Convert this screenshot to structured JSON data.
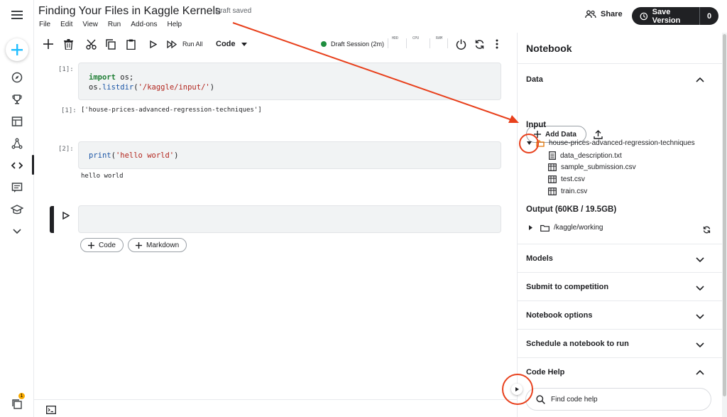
{
  "header": {
    "title": "Finding Your Files in Kaggle Kernels",
    "draft_status": "Draft saved",
    "menu": [
      "File",
      "Edit",
      "View",
      "Run",
      "Add-ons",
      "Help"
    ],
    "share_label": "Share",
    "save_label": "Save Version",
    "save_count": "0"
  },
  "toolbar": {
    "run_all_label": "Run All",
    "cell_type": "Code",
    "session_label": "Draft Session (2m)",
    "resource_labels": [
      "HDD",
      "CPU",
      "RAM"
    ],
    "session_status_color": "#1e8e3e"
  },
  "cells": [
    {
      "number": "[1]:",
      "code_lines": [
        [
          {
            "t": "import",
            "c": "kw"
          },
          {
            "t": " os;",
            "c": ""
          }
        ],
        [
          {
            "t": "os.",
            "c": ""
          },
          {
            "t": "listdir",
            "c": "fn"
          },
          {
            "t": "(",
            "c": ""
          },
          {
            "t": "'/kaggle/input/'",
            "c": "str"
          },
          {
            "t": ")",
            "c": ""
          }
        ]
      ],
      "output_number": "[1]:",
      "output": "['house-prices-advanced-regression-techniques']"
    },
    {
      "number": "[2]:",
      "code_lines": [
        [
          {
            "t": "print",
            "c": "fn"
          },
          {
            "t": "(",
            "c": ""
          },
          {
            "t": "'hello world'",
            "c": "str"
          },
          {
            "t": ")",
            "c": ""
          }
        ]
      ],
      "output": "hello world"
    }
  ],
  "add_cell": {
    "code_label": "Code",
    "markdown_label": "Markdown"
  },
  "sidebar": {
    "notification_count": "1"
  },
  "panel": {
    "title": "Notebook",
    "data_section": "Data",
    "add_data_label": "Add Data",
    "input_label": "Input",
    "dataset_name": "house-prices-advanced-regression-techniques",
    "files": [
      "data_description.txt",
      "sample_submission.csv",
      "test.csv",
      "train.csv"
    ],
    "output_label": "Output (60KB / 19.5GB)",
    "working_dir": "/kaggle/working",
    "sections": [
      "Models",
      "Submit to competition",
      "Notebook options",
      "Schedule a notebook to run"
    ],
    "code_help_label": "Code Help",
    "find_code_placeholder": "Find code help"
  },
  "colors": {
    "accent_annotation": "#e8401c",
    "primary_dark": "#202124",
    "add_button_blue": "#20beff"
  }
}
